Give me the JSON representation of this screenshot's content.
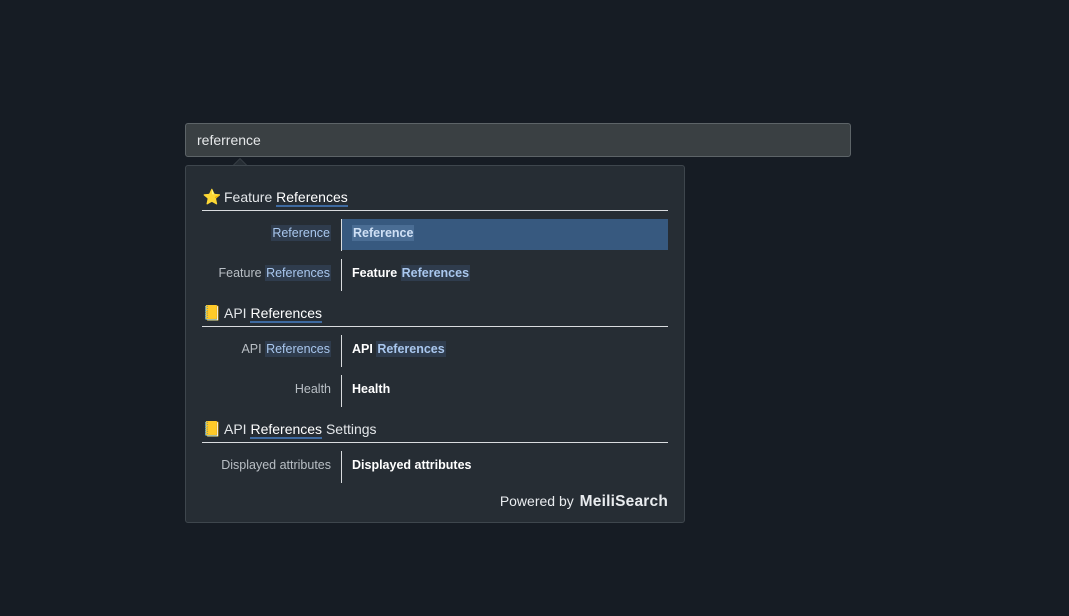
{
  "search": {
    "value": "referrence"
  },
  "dropdown": {
    "categories": [
      {
        "icon": "⭐",
        "icon_name": "star-icon",
        "label_prefix": "Feature ",
        "label_match": "References",
        "label_suffix": "",
        "results": [
          {
            "sub_prefix": "",
            "sub_match": "Reference",
            "main_prefix": "",
            "main_match": "Reference",
            "active": true
          },
          {
            "sub_prefix": "Feature ",
            "sub_match": "References",
            "main_prefix": "Feature ",
            "main_match": "References",
            "active": false
          }
        ]
      },
      {
        "icon": "📒",
        "icon_name": "ledger-icon",
        "label_prefix": "API ",
        "label_match": "References",
        "label_suffix": "",
        "results": [
          {
            "sub_prefix": "API ",
            "sub_match": "References",
            "main_prefix": "API ",
            "main_match": "References",
            "active": false
          },
          {
            "sub_prefix": "Health",
            "sub_match": "",
            "main_prefix": "Health",
            "main_match": "",
            "active": false
          }
        ]
      },
      {
        "icon": "📒",
        "icon_name": "ledger-icon",
        "label_prefix": "API ",
        "label_match": "References",
        "label_suffix": " Settings",
        "results": [
          {
            "sub_prefix": "Displayed attributes",
            "sub_match": "",
            "main_prefix": "Displayed attributes",
            "main_match": "",
            "active": false
          }
        ]
      }
    ],
    "footer": {
      "powered_by": "Powered by",
      "brand": "MeiliSearch"
    }
  },
  "colors": {
    "background": "#161c24",
    "dropdown_bg": "#262d34",
    "active_row": "#37597f",
    "highlight_underline": "#3e6aa0"
  }
}
